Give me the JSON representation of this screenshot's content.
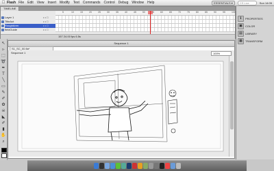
{
  "menubar": {
    "apple": "",
    "app": "Flash",
    "items": [
      "File",
      "Edit",
      "View",
      "Insert",
      "Modify",
      "Text",
      "Commands",
      "Control",
      "Debug",
      "Window",
      "Help"
    ],
    "workspace": "ESSENTIALS ▾",
    "search_placeholder": "CS Live",
    "clock": "Sun 14:05"
  },
  "timeline": {
    "tabs": [
      "TIMELINE"
    ],
    "layers": [
      {
        "name": "Layer 1",
        "selected": false
      },
      {
        "name": "TitleAct",
        "selected": false
      },
      {
        "name": "RoughAnm",
        "selected": true
      },
      {
        "name": "fieldGuide",
        "selected": false
      }
    ],
    "ruler": [
      "5",
      "10",
      "15",
      "20",
      "25",
      "30",
      "35",
      "40",
      "45",
      "50",
      "55",
      "60",
      "65",
      "70",
      "75",
      "80",
      "85",
      "90",
      "95",
      "100"
    ],
    "status": "157    24.00 fps    6.5s"
  },
  "right_panel": [
    {
      "icon": "properties-icon",
      "glyph": "ℹ",
      "label": "PROPERTIES"
    },
    {
      "icon": "color-icon",
      "glyph": "▣",
      "label": "COLOR"
    },
    {
      "icon": "library-icon",
      "glyph": "▤",
      "label": "LIBRARY"
    },
    {
      "icon": "transform-icon",
      "glyph": "▦",
      "label": "TRANSFORM"
    }
  ],
  "document": {
    "title": "Sequence 1",
    "tab": "S1_SC_00.fla*",
    "breadcrumb": "Sequence 1",
    "zoom": "100%"
  },
  "colors": {
    "selected_layer": "#3a5fc8",
    "playhead": "#e02020",
    "stroke": "#000000",
    "fill": "#ffffff"
  },
  "tools": [
    "arrow",
    "subselect",
    "free-transform",
    "lasso",
    "pen",
    "text",
    "line",
    "rectangle",
    "pencil",
    "brush",
    "deco",
    "bone",
    "paint-bucket",
    "eyedropper",
    "eraser",
    "hand",
    "zoom"
  ],
  "dock": [
    "finder",
    "dashboard",
    "mail",
    "safari",
    "ichat",
    "itunes",
    "photoshop",
    "flash",
    "illustrator",
    "bridge",
    "preview",
    "system-prefs",
    "terminal",
    "calendar",
    "folder",
    "trash"
  ]
}
